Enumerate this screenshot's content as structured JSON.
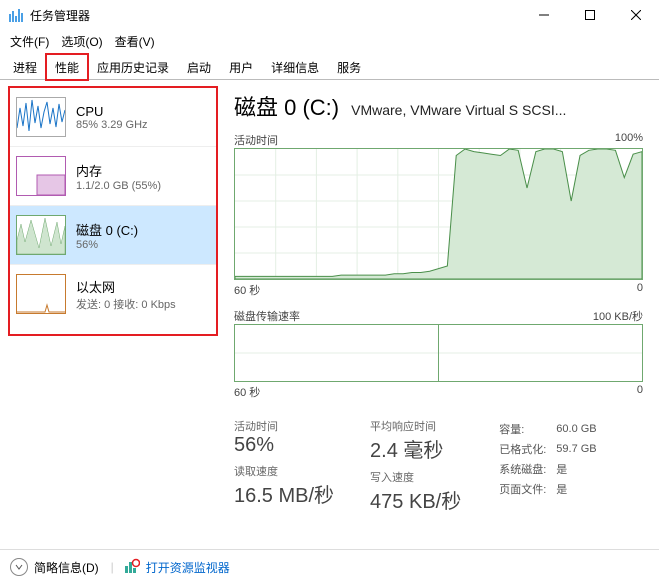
{
  "window": {
    "title": "任务管理器"
  },
  "menu": {
    "file": "文件(F)",
    "options": "选项(O)",
    "view": "查看(V)"
  },
  "tabs": {
    "processes": "进程",
    "performance": "性能",
    "app_history": "应用历史记录",
    "startup": "启动",
    "users": "用户",
    "details": "详细信息",
    "services": "服务"
  },
  "sidebar": {
    "cpu": {
      "title": "CPU",
      "sub": "85%  3.29 GHz"
    },
    "mem": {
      "title": "内存",
      "sub": "1.1/2.0 GB (55%)"
    },
    "disk": {
      "title": "磁盘 0 (C:)",
      "sub": "56%"
    },
    "eth": {
      "title": "以太网",
      "sub": "发送: 0  接收: 0 Kbps"
    }
  },
  "detail": {
    "title": "磁盘 0 (C:)",
    "sub": "VMware, VMware Virtual S SCSI...",
    "chart1": {
      "label_left": "活动时间",
      "label_right": "100%",
      "axis_left": "60 秒",
      "axis_right": "0"
    },
    "chart2": {
      "label_left": "磁盘传输速率",
      "label_right": "100 KB/秒",
      "axis_left": "60 秒",
      "axis_right": "0"
    },
    "stats": {
      "active_lbl": "活动时间",
      "active_val": "56%",
      "avg_lbl": "平均响应时间",
      "avg_val": "2.4 毫秒",
      "read_lbl": "读取速度",
      "read_val": "16.5 MB/秒",
      "write_lbl": "写入速度",
      "write_val": "475 KB/秒",
      "capacity_k": "容量:",
      "capacity_v": "60.0 GB",
      "formatted_k": "已格式化:",
      "formatted_v": "59.7 GB",
      "sysdisk_k": "系统磁盘:",
      "sysdisk_v": "是",
      "pagefile_k": "页面文件:",
      "pagefile_v": "是"
    }
  },
  "bottom": {
    "brief": "简略信息(D)",
    "resmon": "打开资源监视器"
  },
  "chart_data": {
    "type": "area",
    "title": "活动时间",
    "ylabel": "%",
    "ylim": [
      0,
      100
    ],
    "x_span_seconds": 60,
    "series": [
      {
        "name": "Active time %",
        "values": [
          2,
          2,
          2,
          2,
          2,
          2,
          2,
          2,
          2,
          2,
          2,
          2,
          3,
          3,
          3,
          3,
          3,
          3,
          4,
          4,
          5,
          5,
          6,
          8,
          10,
          95,
          100,
          98,
          97,
          96,
          95,
          100,
          99,
          70,
          98,
          100,
          100,
          98,
          60,
          95,
          99,
          100,
          100,
          99,
          78,
          96,
          98
        ]
      }
    ]
  }
}
